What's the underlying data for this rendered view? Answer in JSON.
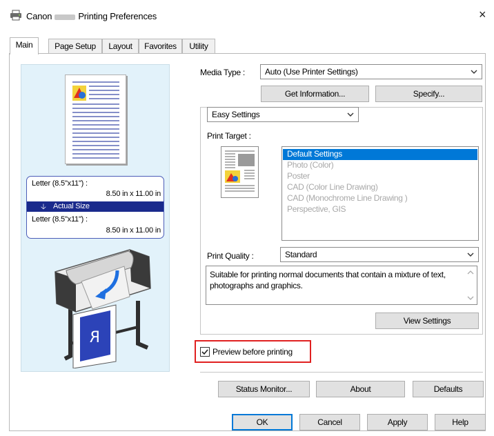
{
  "window": {
    "title_left": "Canon",
    "title_right": "Printing Preferences",
    "close_glyph": "×"
  },
  "tabs": [
    {
      "label": "Main",
      "active": true
    },
    {
      "label": "Page Setup"
    },
    {
      "label": "Layout"
    },
    {
      "label": "Favorites"
    },
    {
      "label": "Utility"
    }
  ],
  "preview": {
    "top_paper": "Letter (8.5\"x11\") :",
    "top_dims": "8.50 in x 11.00 in",
    "arrow_glyph": "🡣",
    "actual_size": "Actual Size",
    "bottom_paper": "Letter (8.5\"x11\") :",
    "bottom_dims": "8.50 in x 11.00 in"
  },
  "media": {
    "label": "Media Type :",
    "value": "Auto (Use Printer Settings)",
    "get_info": "Get Information...",
    "specify": "Specify..."
  },
  "settings_mode": "Easy Settings",
  "print_target": {
    "label": "Print Target :",
    "items": [
      "Default Settings",
      "Photo (Color)",
      "Poster",
      "CAD (Color Line Drawing)",
      "CAD (Monochrome Line Drawing )",
      "Perspective, GIS"
    ],
    "selected_index": 0
  },
  "print_quality": {
    "label": "Print Quality :",
    "value": "Standard"
  },
  "description": "Suitable for printing normal documents that contain a mixture of text, photographs and graphics.",
  "view_settings": "View Settings",
  "preview_before_printing": {
    "label": "Preview before printing",
    "checked": true
  },
  "bottom_buttons": {
    "status_monitor": "Status Monitor...",
    "about": "About",
    "defaults": "Defaults"
  },
  "dialog_buttons": {
    "ok": "OK",
    "cancel": "Cancel",
    "apply": "Apply",
    "help": "Help"
  },
  "colors": {
    "accent": "#0078d7",
    "highlight_red": "#e02020",
    "actual_size_band": "#1a2a8c",
    "preview_bg": "#e2f2fa"
  }
}
